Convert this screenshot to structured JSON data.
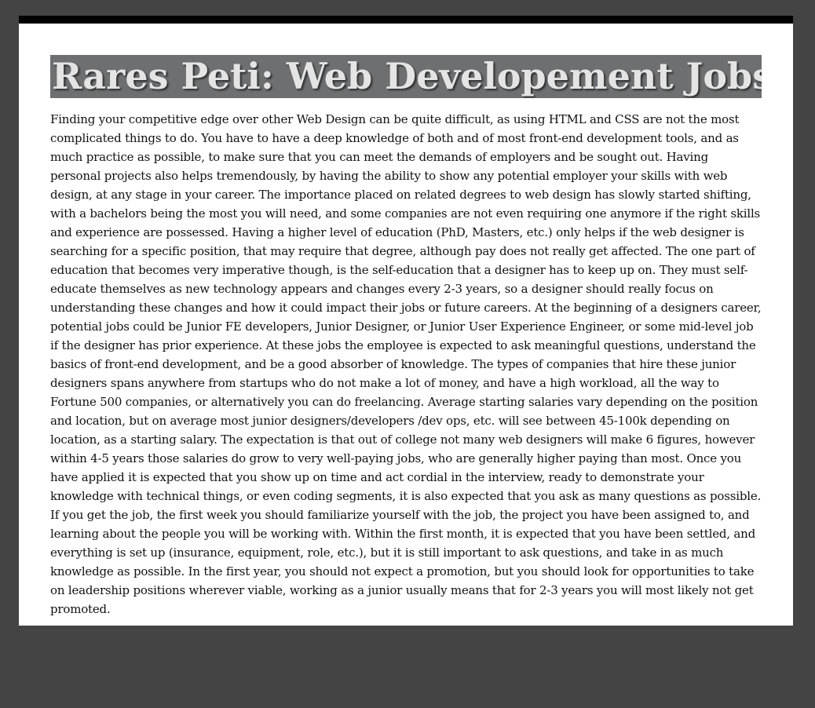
{
  "page": {
    "title": "Rares Peti: Web Developement Jobs",
    "body": "Finding your competitive edge over other Web Design can be quite difficult, as using HTML and CSS are not the most complicated things to do. You have to have a deep knowledge of both and of most front-end development tools, and as much practice as possible, to make sure that you can meet the demands of employers and be sought out. Having personal projects also helps tremendously, by having the ability to show any potential employer your skills with web design, at any stage in your career. The importance placed on related degrees to web design has slowly started shifting, with a bachelors being the most you will need, and some companies are not even requiring one anymore if the right skills and experience are possessed. Having a higher level of education (PhD, Masters, etc.) only helps if the web designer is searching for a specific position, that may require that degree, although pay does not really get affected. The one part of education that becomes very imperative though, is the self-education that a designer has to keep up on. They must self-educate themselves as new technology appears and changes every 2-3 years, so a designer should really focus on understanding these changes and how it could impact their jobs or future careers. At the beginning of a designers career, potential jobs could be Junior FE developers, Junior Designer, or Junior User Experience Engineer, or some mid-level job if the designer has prior experience. At these jobs the employee is expected to ask meaningful questions, understand the basics of front-end development, and be a good absorber of knowledge. The types of companies that hire these junior designers spans anywhere from startups who do not make a lot of money, and have a high workload, all the way to Fortune 500 companies, or alternatively you can do freelancing. Average starting salaries vary depending on the position and location, but on average most junior designers/developers /dev ops, etc. will see between 45-100k depending on location, as a starting salary. The expectation is that out of college not many web designers will make 6 figures, however within 4-5 years those salaries do grow to very well-paying jobs, who are generally higher paying than most. Once you have applied it is expected that you show up on time and act cordial in the interview, ready to demonstrate your knowledge with technical things, or even coding segments, it is also expected that you ask as many questions as possible. If you get the job, the first week you should familiarize yourself with the job, the project you have been assigned to, and learning about the people you will be working with. Within the first month, it is expected that you have been settled, and everything is set up (insurance, equipment, role, etc.), but it is still important to ask questions, and take in as much knowledge as possible. In the first year, you should not expect a promotion, but you should look for opportunities to take on leadership positions wherever viable, working as a junior usually means that for 2-3 years you will most likely not get promoted."
  },
  "colors": {
    "page_background": "#444444",
    "top_bar": "#000000",
    "content_background": "#ffffff",
    "title_background": "#6d6f71",
    "title_text": "#e4e4e4",
    "body_text": "#111111"
  }
}
